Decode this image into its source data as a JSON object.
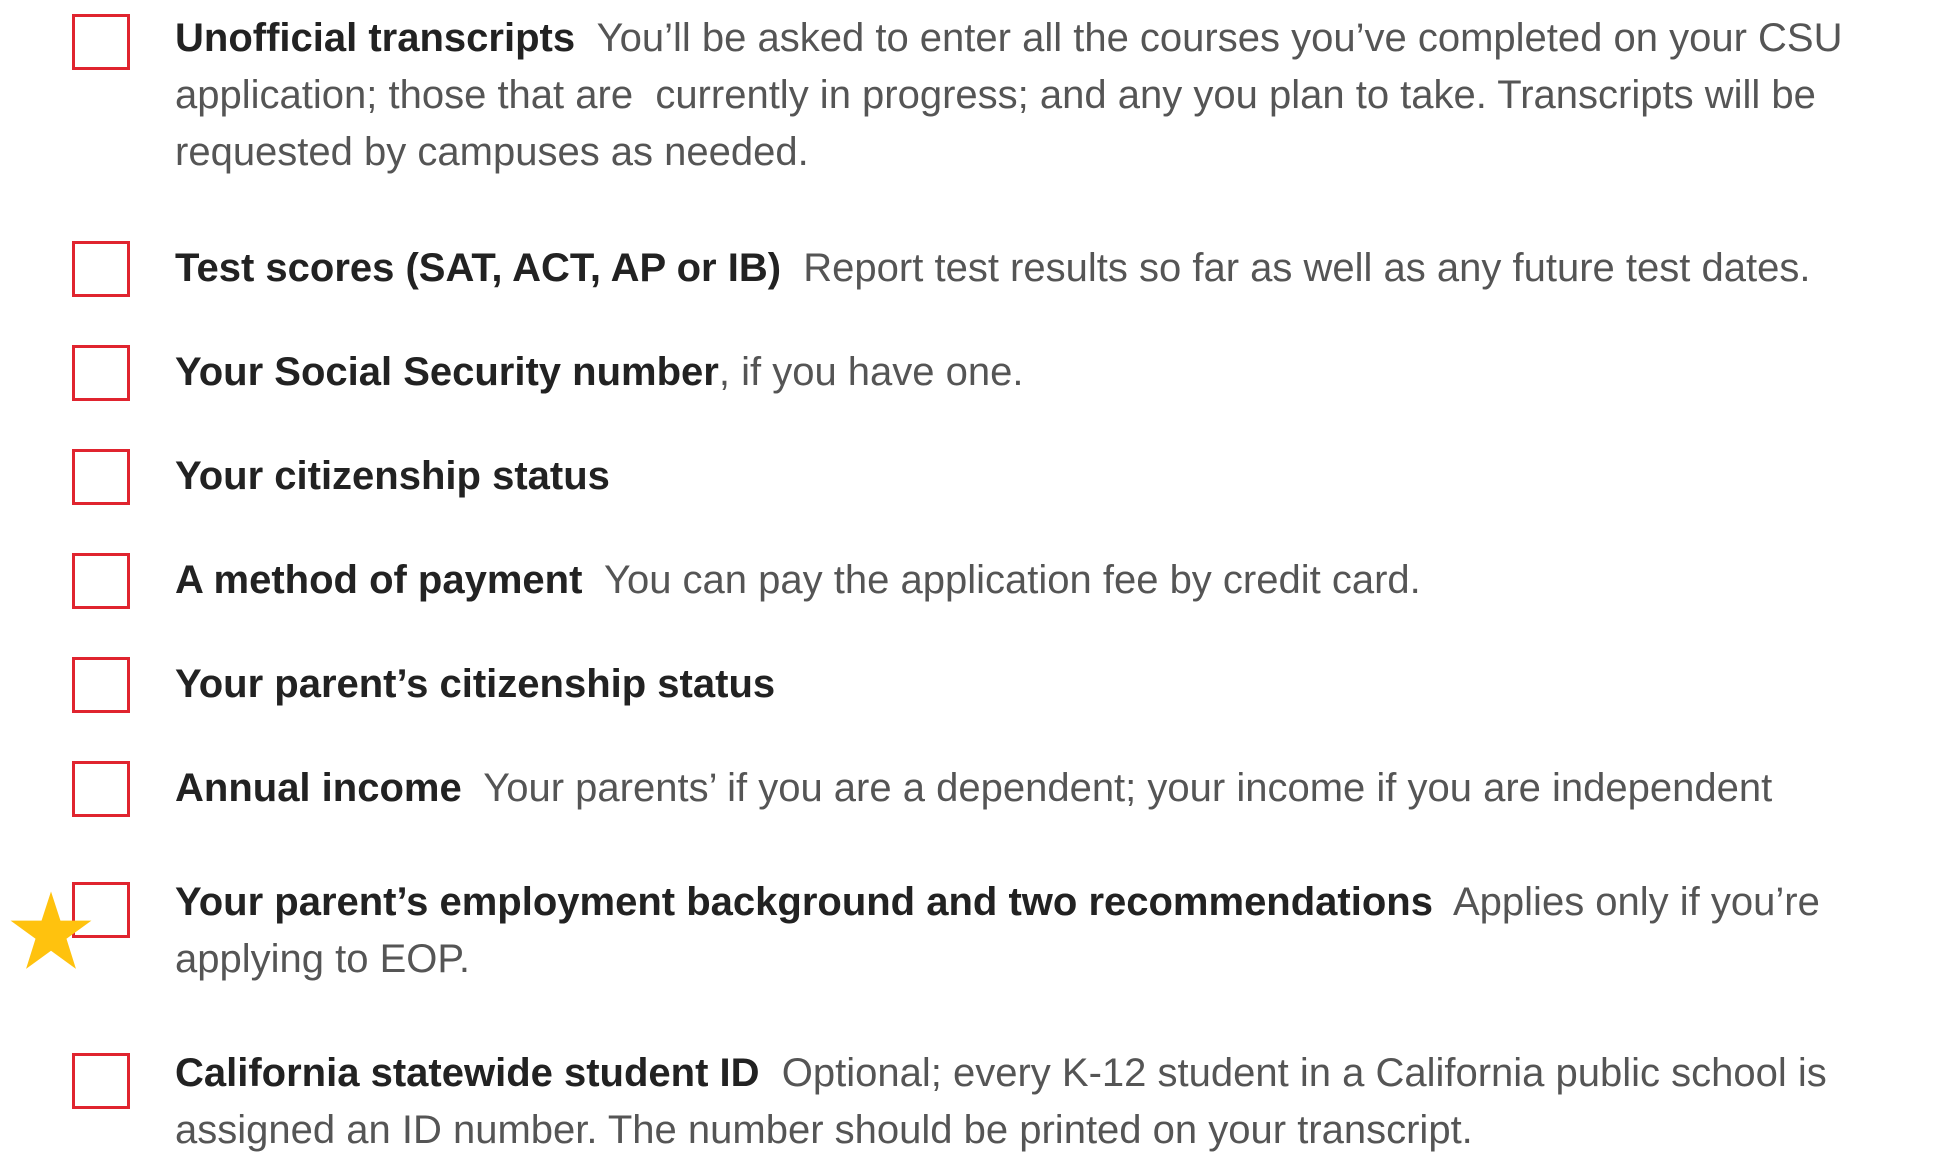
{
  "colors": {
    "checkbox_border": "#e0242f",
    "title_text": "#222222",
    "body_text": "#555555",
    "star": "#ffc20e"
  },
  "items": [
    {
      "title": "Unofficial transcripts",
      "separator": "  ",
      "line1": "You’ll be asked to enter all the courses you’ve completed on your CSU",
      "line2": "application; those that are  currently in progress; and any you plan to take. Transcripts will be",
      "line3": "requested by campuses as needed."
    },
    {
      "title": "Test scores (SAT, ACT, AP or IB)",
      "separator": "  ",
      "line1": "Report test results so far as well as any future test dates."
    },
    {
      "title": "Your Social Security number",
      "separator": "",
      "line1": ", if you have one."
    },
    {
      "title": "Your citizenship status"
    },
    {
      "title": "A method of payment",
      "separator": "  ",
      "line1": "You can pay the application fee by credit card."
    },
    {
      "title": "Your parent’s citizenship status"
    },
    {
      "title": "Annual income",
      "separator": "  ",
      "line1": "Your parents’ if you are a dependent; your income if you are independent"
    },
    {
      "title": "Your parent’s employment background and two recommendations",
      "separator": "  ",
      "line1": "Applies only if you’re",
      "line2": "applying to EOP.",
      "icon": "star-icon"
    },
    {
      "title": "California statewide student ID",
      "separator": "  ",
      "line1": "Optional; every K-12 student in a California public school is",
      "line2": "assigned an ID number. The number should be printed on your transcript."
    }
  ]
}
